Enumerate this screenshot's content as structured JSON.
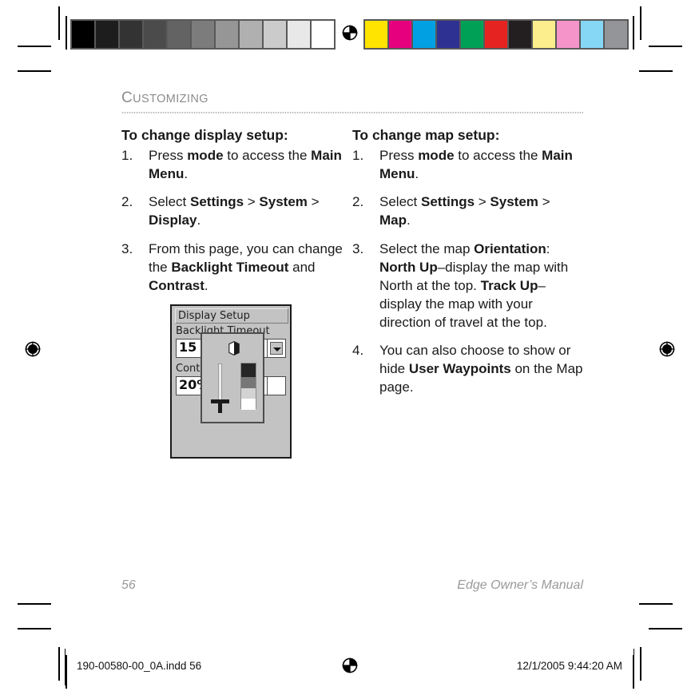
{
  "page": {
    "running_head": "Customizing",
    "running_head_first_letter": "C",
    "running_head_rest": "USTOMIZING",
    "page_number": "56",
    "manual_title": "Edge Owner’s Manual"
  },
  "left_column": {
    "title": "To change display setup:",
    "steps": [
      {
        "num": "1.",
        "parts": [
          {
            "t": "Press ",
            "b": false
          },
          {
            "t": "mode",
            "b": true
          },
          {
            "t": " to access the ",
            "b": false
          },
          {
            "t": "Main Menu",
            "b": true
          },
          {
            "t": ".",
            "b": false
          }
        ]
      },
      {
        "num": "2.",
        "parts": [
          {
            "t": "Select ",
            "b": false
          },
          {
            "t": "Settings",
            "b": true
          },
          {
            "t": " > ",
            "b": false
          },
          {
            "t": "System",
            "b": true
          },
          {
            "t": " > ",
            "b": false
          },
          {
            "t": "Display",
            "b": true
          },
          {
            "t": ".",
            "b": false
          }
        ]
      },
      {
        "num": "3.",
        "parts": [
          {
            "t": "From this page, you can change the ",
            "b": false
          },
          {
            "t": "Backlight Timeout",
            "b": true
          },
          {
            "t": " and ",
            "b": false
          },
          {
            "t": "Contrast",
            "b": true
          },
          {
            "t": ".",
            "b": false
          }
        ]
      }
    ]
  },
  "right_column": {
    "title": "To change map setup:",
    "steps": [
      {
        "num": "1.",
        "parts": [
          {
            "t": "Press ",
            "b": false
          },
          {
            "t": "mode",
            "b": true
          },
          {
            "t": " to access the ",
            "b": false
          },
          {
            "t": "Main Menu",
            "b": true
          },
          {
            "t": ".",
            "b": false
          }
        ]
      },
      {
        "num": "2.",
        "parts": [
          {
            "t": "Select ",
            "b": false
          },
          {
            "t": "Settings",
            "b": true
          },
          {
            "t": " > ",
            "b": false
          },
          {
            "t": "System",
            "b": true
          },
          {
            "t": " > ",
            "b": false
          },
          {
            "t": "Map",
            "b": true
          },
          {
            "t": ".",
            "b": false
          }
        ]
      },
      {
        "num": "3.",
        "parts": [
          {
            "t": "Select the map ",
            "b": false
          },
          {
            "t": "Orientation",
            "b": true
          },
          {
            "t": ": ",
            "b": false
          },
          {
            "t": "North Up",
            "b": true
          },
          {
            "t": "–display the map with North at the top. ",
            "b": false
          },
          {
            "t": "Track Up",
            "b": true
          },
          {
            "t": "–display the map with your direction of travel at the top.",
            "b": false
          }
        ]
      },
      {
        "num": "4.",
        "parts": [
          {
            "t": "You can also choose to show or hide ",
            "b": false
          },
          {
            "t": "User Waypoints",
            "b": true
          },
          {
            "t": " on the Map page.",
            "b": false
          }
        ]
      }
    ]
  },
  "device_screenshot": {
    "title": "Display Setup",
    "backlight_label": "Backlight Timeout",
    "backlight_value": "15",
    "contrast_label": "Contrast",
    "contrast_value": "20%",
    "dropdown_icon": "chevron-down-icon",
    "popup_icon": "contrast-half-circle-icon"
  },
  "calibration": {
    "grayscale": [
      "#000000",
      "#1d1d1d",
      "#333333",
      "#4b4b4b",
      "#636363",
      "#7c7c7c",
      "#969696",
      "#b0b0b0",
      "#cbcbcb",
      "#e8e8e8",
      "#ffffff"
    ],
    "colors": [
      "#ffe400",
      "#e6007e",
      "#00a0e3",
      "#2e3192",
      "#00a157",
      "#e52421",
      "#231f20",
      "#fcee8c",
      "#f494c8",
      "#86d6f5",
      "#939598"
    ]
  },
  "slug": {
    "filename": "190-00580-00_0A.indd   56",
    "timestamp": "12/1/2005   9:44:20 AM"
  }
}
